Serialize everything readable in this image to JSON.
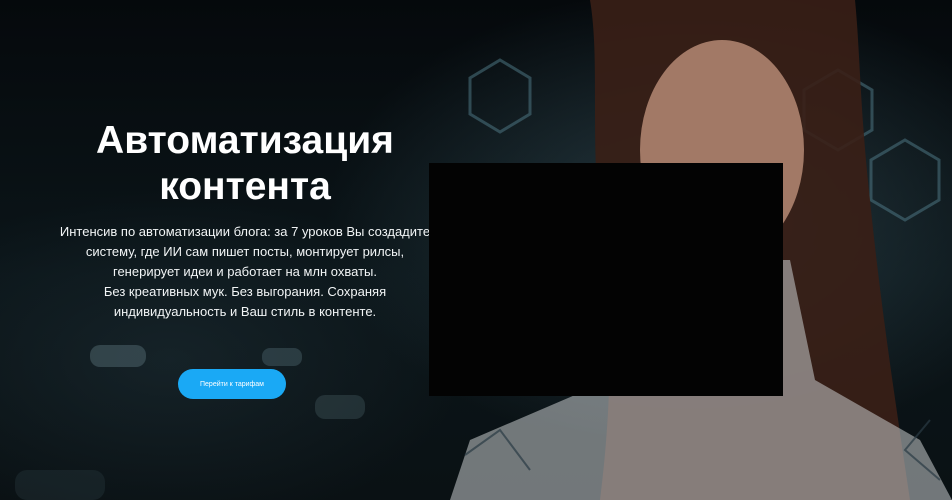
{
  "hero": {
    "title": "Автоматизация контента",
    "description_lines": [
      "Интенсив по автоматизации блога: за 7 уроков Вы создадите",
      "систему, где ИИ сам пишет посты, монтирует рилсы,",
      "генерирует идеи и работает на млн охваты.",
      "Без креативных мук. Без выгорания. Сохраняя",
      "индивидуальность и Ваш стиль в контенте."
    ],
    "cta_label": "Перейти к тарифам"
  },
  "colors": {
    "accent": "#1aa9f5",
    "background": "#071014",
    "text": "#ffffff",
    "media_placeholder": "#030303"
  }
}
